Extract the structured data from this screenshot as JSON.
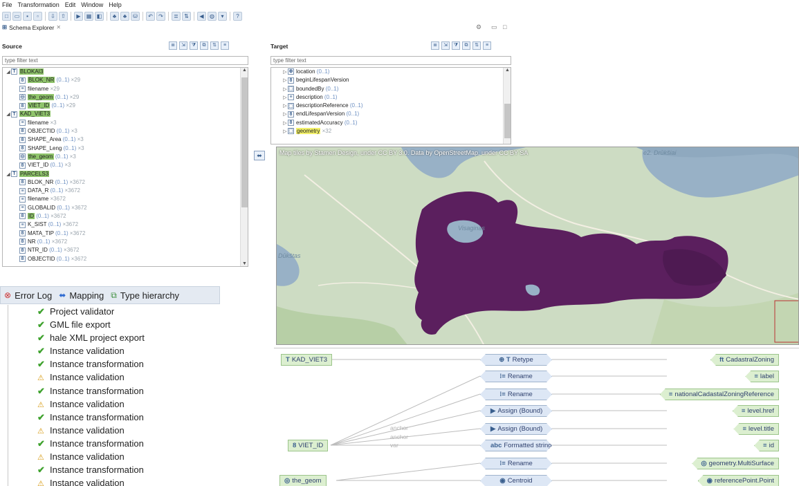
{
  "menu": [
    "File",
    "Transformation",
    "Edit",
    "Window",
    "Help"
  ],
  "view": {
    "title": "Schema Explorer",
    "close_glyph": "✕",
    "controls": [
      "⚙",
      "▭",
      "□"
    ]
  },
  "source": {
    "title": "Source",
    "filter_placeholder": "type filter text",
    "rows": [
      {
        "indent": 0,
        "tw": "◢",
        "icon": "T",
        "name": "BLOKAI3",
        "card": "",
        "count": "",
        "hl": "green"
      },
      {
        "indent": 1,
        "tw": "",
        "icon": "8",
        "name": "BLOK_NR",
        "card": "(0..1)",
        "count": "×29",
        "hl": "green"
      },
      {
        "indent": 1,
        "tw": "",
        "icon": "≡",
        "name": "filename",
        "card": "",
        "count": "×29",
        "hl": ""
      },
      {
        "indent": 1,
        "tw": "",
        "icon": "◎",
        "name": "the_geom",
        "card": "(0..1)",
        "count": "×29",
        "hl": "green"
      },
      {
        "indent": 1,
        "tw": "",
        "icon": "8",
        "name": "VIET_ID",
        "card": "(0..1)",
        "count": "×29",
        "hl": "green"
      },
      {
        "indent": 0,
        "tw": "◢",
        "icon": "T",
        "name": "KAD_VIET3",
        "card": "",
        "count": "",
        "hl": "green"
      },
      {
        "indent": 1,
        "tw": "",
        "icon": "≡",
        "name": "filename",
        "card": "",
        "count": "×3",
        "hl": ""
      },
      {
        "indent": 1,
        "tw": "",
        "icon": "8",
        "name": "OBJECTID",
        "card": "(0..1)",
        "count": "×3",
        "hl": ""
      },
      {
        "indent": 1,
        "tw": "",
        "icon": "8",
        "name": "SHAPE_Area",
        "card": "(0..1)",
        "count": "×3",
        "hl": ""
      },
      {
        "indent": 1,
        "tw": "",
        "icon": "8",
        "name": "SHAPE_Leng",
        "card": "(0..1)",
        "count": "×3",
        "hl": ""
      },
      {
        "indent": 1,
        "tw": "",
        "icon": "◎",
        "name": "the_geom",
        "card": "(0..1)",
        "count": "×3",
        "hl": "green"
      },
      {
        "indent": 1,
        "tw": "",
        "icon": "8",
        "name": "VIET_ID",
        "card": "(0..1)",
        "count": "×3",
        "hl": ""
      },
      {
        "indent": 0,
        "tw": "◢",
        "icon": "T",
        "name": "PARCELS3",
        "card": "",
        "count": "",
        "hl": "green"
      },
      {
        "indent": 1,
        "tw": "",
        "icon": "8",
        "name": "BLOK_NR",
        "card": "(0..1)",
        "count": "×3672",
        "hl": ""
      },
      {
        "indent": 1,
        "tw": "",
        "icon": "≡",
        "name": "DATA_R",
        "card": "(0..1)",
        "count": "×3672",
        "hl": ""
      },
      {
        "indent": 1,
        "tw": "",
        "icon": "≡",
        "name": "filename",
        "card": "",
        "count": "×3672",
        "hl": ""
      },
      {
        "indent": 1,
        "tw": "",
        "icon": "≡",
        "name": "GLOBALID",
        "card": "(0..1)",
        "count": "×3672",
        "hl": ""
      },
      {
        "indent": 1,
        "tw": "",
        "icon": "8",
        "name": "ID",
        "card": "(0..1)",
        "count": "×3672",
        "hl": "green"
      },
      {
        "indent": 1,
        "tw": "",
        "icon": "≡",
        "name": "K_SIST",
        "card": "(0..1)",
        "count": "×3672",
        "hl": ""
      },
      {
        "indent": 1,
        "tw": "",
        "icon": "8",
        "name": "MATA_TIP",
        "card": "(0..1)",
        "count": "×3672",
        "hl": ""
      },
      {
        "indent": 1,
        "tw": "",
        "icon": "8",
        "name": "NR",
        "card": "(0..1)",
        "count": "×3672",
        "hl": ""
      },
      {
        "indent": 1,
        "tw": "",
        "icon": "8",
        "name": "NTR_ID",
        "card": "(0..1)",
        "count": "×3672",
        "hl": ""
      },
      {
        "indent": 1,
        "tw": "",
        "icon": "8",
        "name": "OBJECTID",
        "card": "(0..1)",
        "count": "×3672",
        "hl": ""
      }
    ]
  },
  "target": {
    "title": "Target",
    "filter_placeholder": "type filter text",
    "rows": [
      {
        "indent": 1,
        "tw": "▷",
        "icon": "⊕",
        "name": "location",
        "card": "(0..1)",
        "count": "",
        "hl": ""
      },
      {
        "indent": 1,
        "tw": "▷",
        "icon": "8",
        "name": "beginLifespanVersion",
        "card": "",
        "count": "",
        "hl": ""
      },
      {
        "indent": 1,
        "tw": "▷",
        "icon": "⬚",
        "name": "boundedBy",
        "card": "(0..1)",
        "count": "",
        "hl": ""
      },
      {
        "indent": 1,
        "tw": "▷",
        "icon": "≡",
        "name": "description",
        "card": "(0..1)",
        "count": "",
        "hl": ""
      },
      {
        "indent": 1,
        "tw": "▷",
        "icon": "⬚",
        "name": "descriptionReference",
        "card": "(0..1)",
        "count": "",
        "hl": ""
      },
      {
        "indent": 1,
        "tw": "▷",
        "icon": "8",
        "name": "endLifespanVersion",
        "card": "(0..1)",
        "count": "",
        "hl": ""
      },
      {
        "indent": 1,
        "tw": "▷",
        "icon": "8",
        "name": "estimatedAccuracy",
        "card": "(0..1)",
        "count": "",
        "hl": ""
      },
      {
        "indent": 1,
        "tw": "▷",
        "icon": "⬚",
        "name": "geometry",
        "card": "",
        "count": "×32",
        "hl": "yellow"
      }
    ]
  },
  "map": {
    "attribution": "Map tiles by Stamen Design, under CC BY 3.0. Data by OpenStreetMap, under CC BY SA",
    "labels": [
      "e2. Drūkšiai",
      "Visaginas",
      "Dūkštas"
    ]
  },
  "bottom_tabs": [
    {
      "icon": "⊗",
      "label": "Error Log"
    },
    {
      "icon": "⬌",
      "label": "Mapping"
    },
    {
      "icon": "⧉",
      "label": "Type hierarchy"
    }
  ],
  "log": [
    {
      "status": "ok",
      "label": "Project validator"
    },
    {
      "status": "ok",
      "label": "GML file export"
    },
    {
      "status": "ok",
      "label": "hale XML project export"
    },
    {
      "status": "ok",
      "label": "Instance validation"
    },
    {
      "status": "ok",
      "label": "Instance transformation"
    },
    {
      "status": "warn",
      "label": "Instance validation"
    },
    {
      "status": "ok",
      "label": "Instance transformation"
    },
    {
      "status": "warn",
      "label": "Instance validation"
    },
    {
      "status": "ok",
      "label": "Instance transformation"
    },
    {
      "status": "warn",
      "label": "Instance validation"
    },
    {
      "status": "ok",
      "label": "Instance transformation"
    },
    {
      "status": "warn",
      "label": "Instance validation"
    },
    {
      "status": "ok",
      "label": "Instance transformation"
    },
    {
      "status": "warn",
      "label": "Instance validation"
    }
  ],
  "mapping": {
    "sources": [
      {
        "icon": "T",
        "label": "KAD_VIET3"
      },
      {
        "icon": "8",
        "label": "VIET_ID"
      },
      {
        "icon": "◎",
        "label": "the_geom"
      }
    ],
    "functions": [
      {
        "icon": "⊕ T",
        "label": "Retype"
      },
      {
        "icon": "⁝≡",
        "label": "Rename"
      },
      {
        "icon": "⁝≡",
        "label": "Rename"
      },
      {
        "icon": "▶",
        "label": "Assign (Bound)"
      },
      {
        "icon": "▶",
        "label": "Assign (Bound)"
      },
      {
        "icon": "abc",
        "label": "Formatted string"
      },
      {
        "icon": "⁝≡",
        "label": "Rename"
      },
      {
        "icon": "◉",
        "label": "Centroid"
      }
    ],
    "targets": [
      {
        "icon": "ft",
        "label": "CadastralZoning"
      },
      {
        "icon": "≡",
        "label": "label"
      },
      {
        "icon": "≡",
        "label": "nationalCadastalZoningReference"
      },
      {
        "icon": "≡",
        "label": "level.href"
      },
      {
        "icon": "≡",
        "label": "level.title"
      },
      {
        "icon": "≡",
        "label": "id"
      },
      {
        "icon": "◎",
        "label": "geometry.MultiSurface"
      },
      {
        "icon": "◉",
        "label": "referencePoint.Point"
      }
    ],
    "anchor_labels": [
      "anchor",
      "anchor",
      "var"
    ]
  }
}
